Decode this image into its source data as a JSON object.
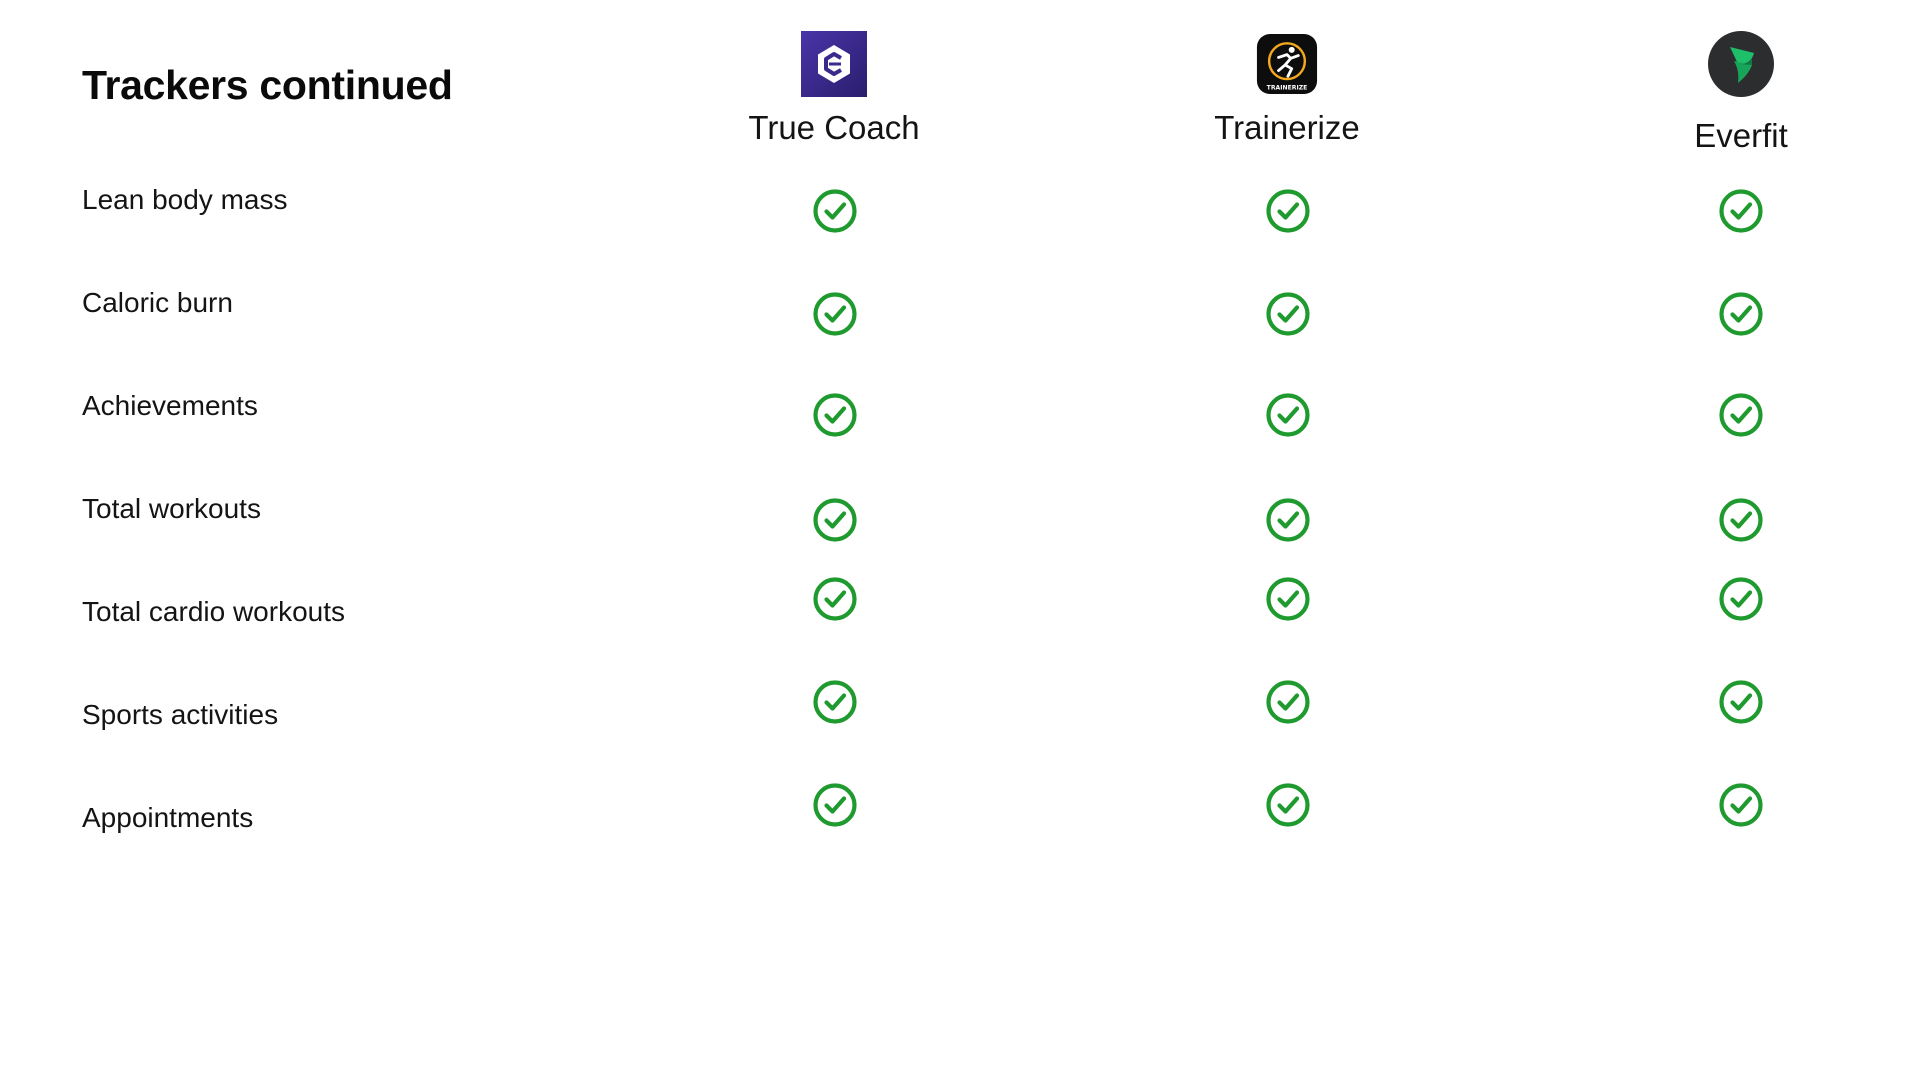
{
  "title": "Trackers continued",
  "apps": [
    {
      "name": "True Coach",
      "icon": "truecoach-logo-icon",
      "color": "#3b2a8c"
    },
    {
      "name": "Trainerize",
      "icon": "trainerize-logo-icon",
      "color": "#0d0d0d",
      "logo_text": "TRAINERIZE"
    },
    {
      "name": "Everfit",
      "icon": "everfit-logo-icon",
      "color": "#2b2d2f"
    }
  ],
  "rows": [
    {
      "label": "Lean body mass",
      "values": [
        true,
        true,
        true
      ]
    },
    {
      "label": "Caloric burn",
      "values": [
        true,
        true,
        true
      ]
    },
    {
      "label": "Achievements",
      "values": [
        true,
        true,
        true
      ]
    },
    {
      "label": "Total workouts",
      "values": [
        true,
        true,
        true
      ]
    },
    {
      "label": "Total cardio workouts",
      "values": [
        true,
        true,
        true
      ]
    },
    {
      "label": "Sports activities",
      "values": [
        true,
        true,
        true
      ]
    },
    {
      "label": "Appointments",
      "values": [
        true,
        true,
        true
      ]
    }
  ],
  "colors": {
    "check": "#1f9a2e",
    "text": "#141414"
  }
}
